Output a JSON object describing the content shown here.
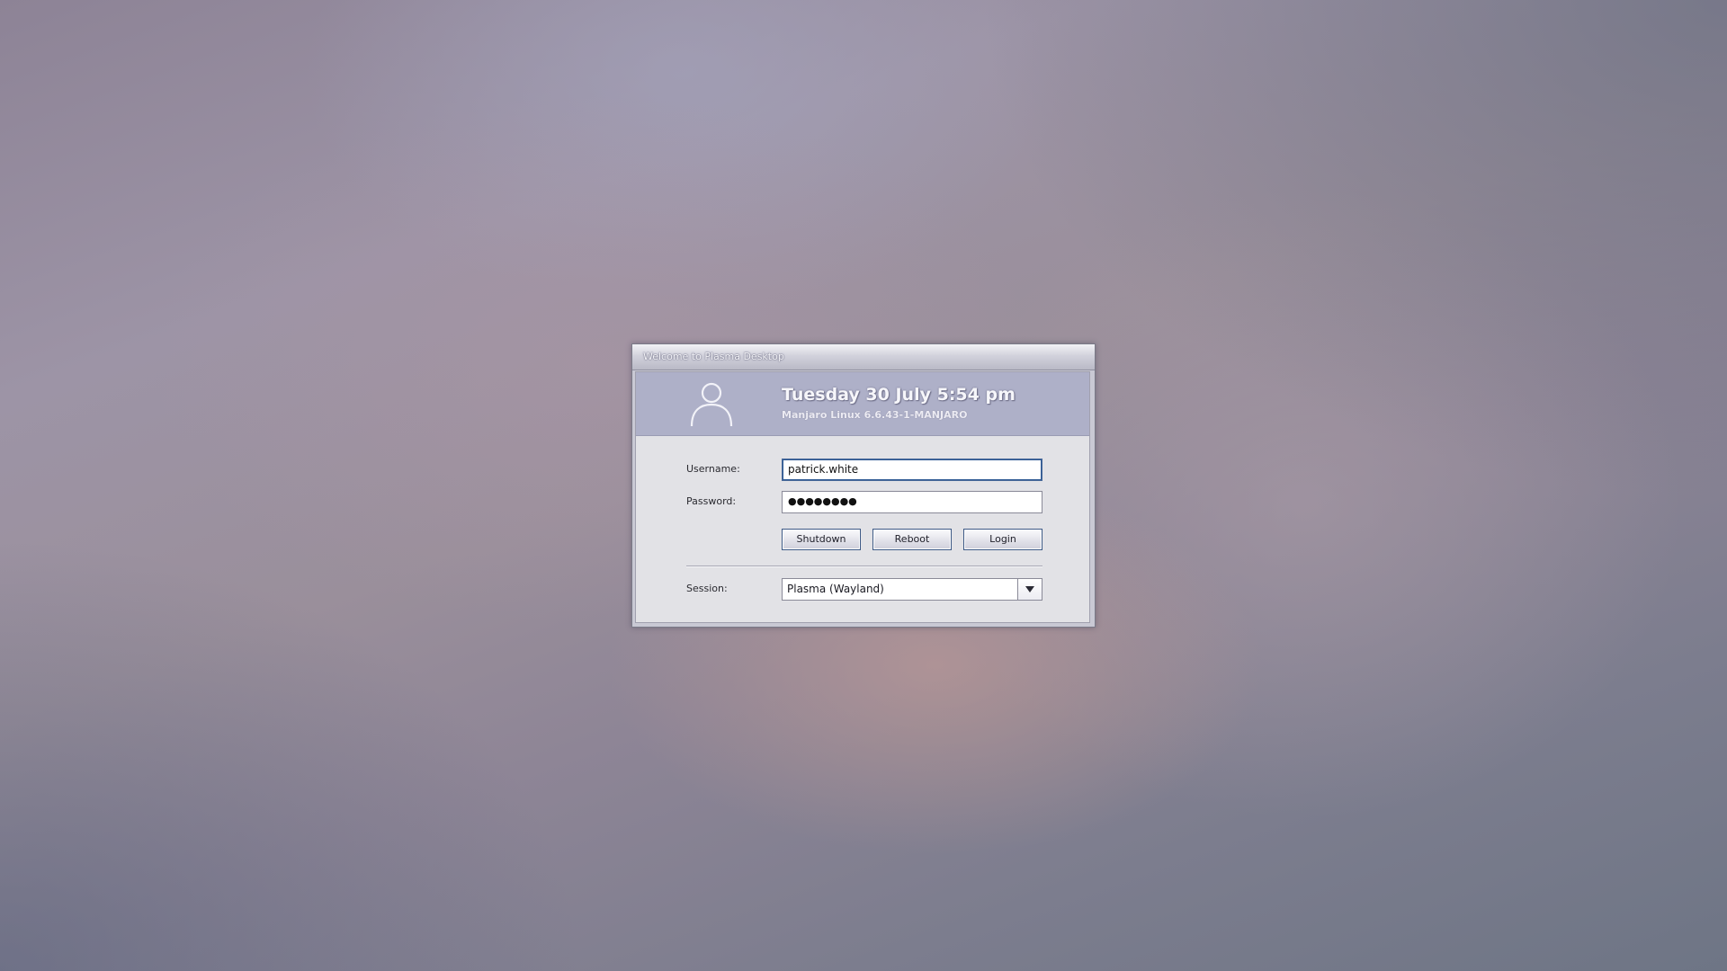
{
  "desktop": {
    "background": "blurred pastel"
  },
  "window": {
    "title": "Welcome to Plasma Desktop"
  },
  "header": {
    "clock": "Tuesday 30 July  5:54 pm",
    "os_version": "Manjaro Linux 6.6.43-1-MANJARO",
    "band_color": "#aeb0c8",
    "user_icon": "user-icon"
  },
  "form": {
    "username_label": "Username:",
    "username_value": "patrick.white",
    "password_label": "Password:",
    "password_value": "●●●●●●●●",
    "buttons": {
      "shutdown": "Shutdown",
      "reboot": "Reboot",
      "login": "Login"
    },
    "session_label": "Session:",
    "session_value": "Plasma (Wayland)",
    "session_arrow_icon": "chevron-down-icon"
  },
  "colors": {
    "focus_border": "#2f5a94",
    "button_border": "#3e5a86"
  }
}
